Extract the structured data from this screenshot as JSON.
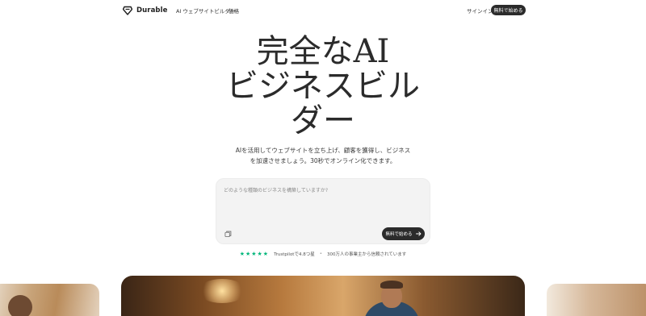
{
  "nav": {
    "brand": "Durable",
    "links": [
      "AI ウェブサイトビルダー",
      "価格"
    ],
    "signin": "サインイン",
    "cta": "無料で始める"
  },
  "hero": {
    "title_lines": [
      "完全なAI",
      "ビジネスビル",
      "ダー"
    ],
    "subtitle": "AIを活用してウェブサイトを立ち上げ、顧客を獲得し、ビジネスを加速させましょう。30秒でオンライン化できます。"
  },
  "prompt": {
    "placeholder": "どのような種類のビジネスを構築していますか?",
    "cta": "無料で始める"
  },
  "trust": {
    "stars": "★★★★★",
    "rating_text": "Trustpilotで4.8つ星",
    "separator": "•",
    "users_text": "300万人の事業主から信頼されています"
  },
  "colors": {
    "primary_dark": "#2b2b2b",
    "trustpilot_green": "#00b67a",
    "prompt_bg": "#f3f3f3"
  },
  "icons": [
    "diamond-logo-icon",
    "attach-icon",
    "arrow-right-icon",
    "star-icon"
  ]
}
